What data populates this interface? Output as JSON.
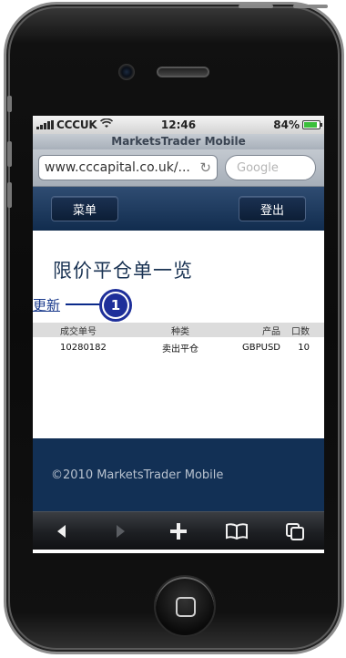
{
  "status_bar": {
    "carrier": "CCCUK",
    "time": "12:46",
    "battery": "84%"
  },
  "browser": {
    "page_title": "MarketsTrader Mobile",
    "url": "www.cccapital.co.uk/...",
    "search_placeholder": "Google"
  },
  "app_header": {
    "menu_label": "菜单",
    "login_label": "登出"
  },
  "main": {
    "title": "限价平仓单一览",
    "refresh_link": "更新",
    "callout_number": "1"
  },
  "table": {
    "columns": [
      "成交单号",
      "种类",
      "产品",
      "口数"
    ],
    "rows": [
      [
        "10280182",
        "卖出平仓",
        "GBPUSD",
        "10"
      ]
    ]
  },
  "footer": {
    "copyright": "©2010 MarketsTrader Mobile"
  },
  "toolbar": {
    "icons": [
      "back-arrow-icon",
      "forward-arrow-icon",
      "plus-icon",
      "bookmarks-icon",
      "pages-icon"
    ]
  },
  "colors": {
    "header_bg": "#112c4e",
    "footer_bg": "#123055",
    "title_text": "#1a3353",
    "callout": "#1e2f9a",
    "battery_fill": "#3cbf3c"
  }
}
